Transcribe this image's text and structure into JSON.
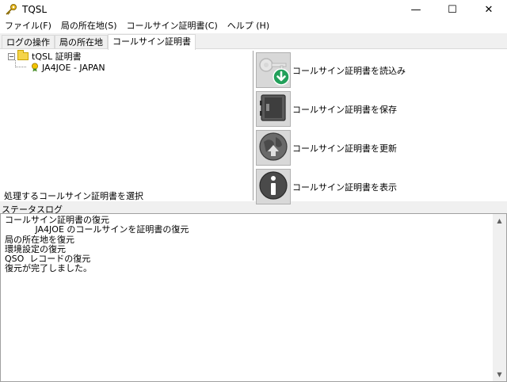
{
  "window": {
    "title": "TQSL",
    "minimize": "—",
    "maximize": "☐",
    "close": "✕"
  },
  "menu": [
    "ファイル(F)",
    "局の所在地(S)",
    "コールサイン証明書(C)",
    "ヘルプ (H)"
  ],
  "tabs": [
    "ログの操作",
    "局の所在地",
    "コールサイン証明書"
  ],
  "tree": {
    "root_label": "tQSL 証明書",
    "expander": "−",
    "child_label": "JA4JOE - JAPAN"
  },
  "panel_status": "処理するコールサイン証明書を選択",
  "actions": [
    {
      "label": "コールサイン証明書を読込み",
      "icon": "key-download-icon"
    },
    {
      "label": "コールサイン証明書を保存",
      "icon": "safe-icon"
    },
    {
      "label": "コールサイン証明書を更新",
      "icon": "renew-globe-icon"
    },
    {
      "label": "コールサイン証明書を表示",
      "icon": "info-icon"
    }
  ],
  "log": {
    "label": "ステータスログ",
    "text": "コールサイン証明書の復元\n           JA4JOE のコールサインを証明書の復元\n局の所在地を復元\n環境設定の復元\nQSO  レコードの復元\n復元が完了しました。"
  },
  "colors": {
    "accent": "#22a05a",
    "folder": "#f5d44a"
  }
}
